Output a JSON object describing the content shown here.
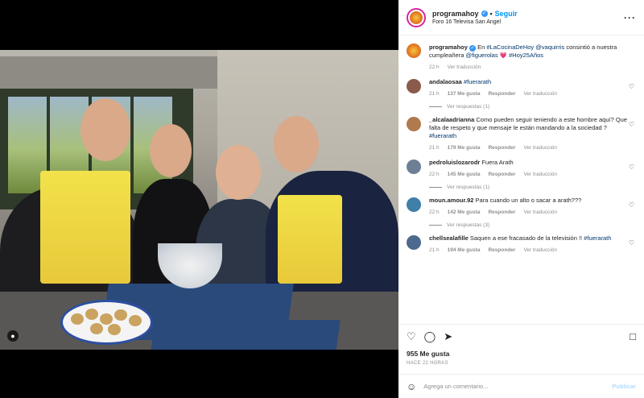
{
  "header": {
    "username": "programahoy",
    "follow_label": "Seguir",
    "location": "Foro 16 Televisa San Angel",
    "more_icon": "ellipsis-icon"
  },
  "caption": {
    "username": "programahoy",
    "text_a": "En ",
    "tag1": "#LaCocinaDeHoy",
    "text_b": " ",
    "mention1": "@vaquirris",
    "text_c": " consintió a nuestra cumpleañera ",
    "mention2": "@figuerolas",
    "text_d": " 💗 ",
    "tag2": "#Hoy25Años",
    "time": "22 h",
    "translate": "Ver traducción"
  },
  "comments": [
    {
      "user": "andalaosaa",
      "pre": "",
      "tag": "#fuerarath",
      "post": "",
      "time": "21 h",
      "likes": "137 Me gusta",
      "reply": "Responder",
      "translate": "Ver traducción",
      "replies": "Ver respuestas (1)",
      "avatar_color": "#8a5b4a"
    },
    {
      "user": "_alcalaadrianna",
      "pre": "Como pueden seguir teniendo a este hombre aquí? Que falta de respeto y que mensaje le están mandando a la sociedad ? ",
      "tag": "#fuerarath",
      "post": "",
      "time": "21 h",
      "likes": "179 Me gusta",
      "reply": "Responder",
      "translate": "Ver traducción",
      "replies": "",
      "avatar_color": "#b07a4e"
    },
    {
      "user": "pedroluislozarodr",
      "pre": "Fuera Arath",
      "tag": "",
      "post": "",
      "time": "22 h",
      "likes": "145 Me gusta",
      "reply": "Responder",
      "translate": "Ver traducción",
      "replies": "Ver respuestas (1)",
      "avatar_color": "#6d7f95"
    },
    {
      "user": "moun.amour.92",
      "pre": "Para cuando un alto o sacar a arath???",
      "tag": "",
      "post": "",
      "time": "22 h",
      "likes": "142 Me gusta",
      "reply": "Responder",
      "translate": "Ver traducción",
      "replies": "Ver respuestas (3)",
      "avatar_color": "#3f7fa8"
    },
    {
      "user": "chellsealafille",
      "pre": "Saquen a ese fracasado de la televisión !! ",
      "tag": "#fuerarath",
      "post": "",
      "time": "21 h",
      "likes": "194 Me gusta",
      "reply": "Responder",
      "translate": "Ver traducción",
      "replies": "",
      "avatar_color": "#4b6a8e"
    }
  ],
  "actions": {
    "like_icon": "heart-icon",
    "comment_icon": "comment-icon",
    "share_icon": "share-icon",
    "save_icon": "bookmark-icon"
  },
  "likes": "955 Me gusta",
  "posted": "HACE 22 HORAS",
  "add_comment": {
    "placeholder": "Agrega un comentario...",
    "publish": "Publicar"
  },
  "colors": {
    "link": "#0095f6",
    "hashtag": "#00376b",
    "muted": "#8e8e8e",
    "apron": "#f2e24a"
  }
}
